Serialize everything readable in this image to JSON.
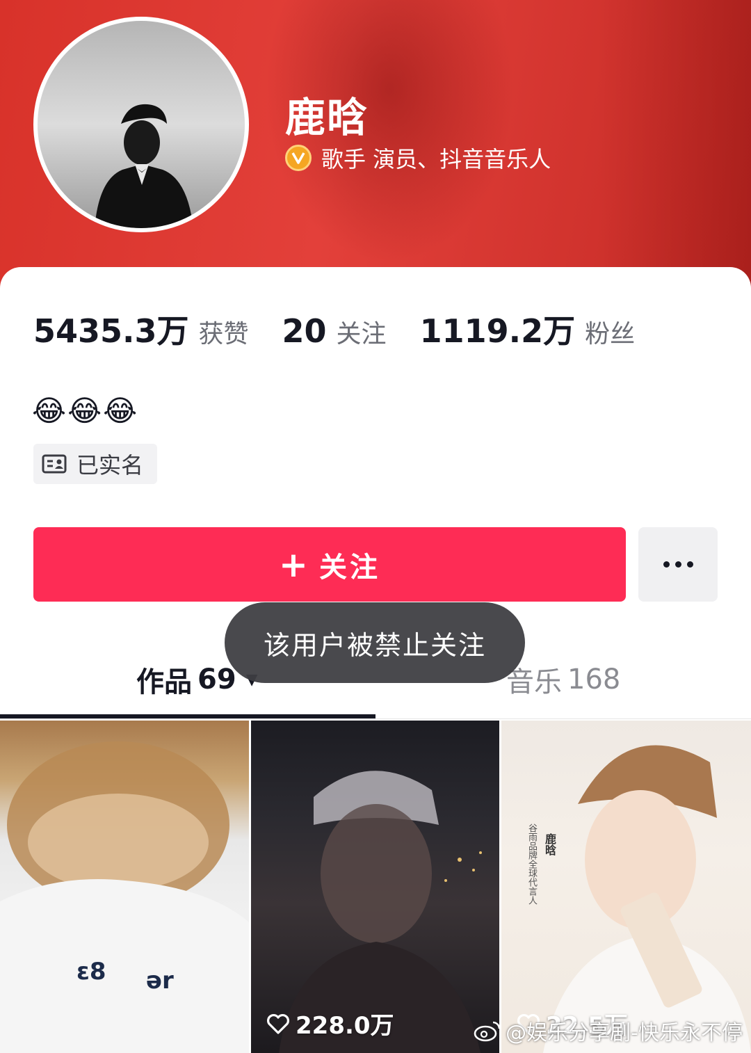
{
  "profile": {
    "name": "鹿晗",
    "verified_title": "歌手 演员、抖音音乐人",
    "bio": "😂😂😂",
    "real_name_tag": "已实名"
  },
  "stats": [
    {
      "value": "5435.3万",
      "label": "获赞"
    },
    {
      "value": "20",
      "label": "关注"
    },
    {
      "value": "1119.2万",
      "label": "粉丝"
    }
  ],
  "actions": {
    "follow_plus": "+",
    "follow_label": "关注"
  },
  "toast": {
    "text": "该用户被禁止关注"
  },
  "tabs": {
    "works": {
      "label": "作品",
      "count": "69"
    },
    "music": {
      "label": "音乐",
      "count": "168"
    }
  },
  "thumbnails": [
    {
      "likes": ""
    },
    {
      "likes": "228.0万"
    },
    {
      "likes": "22.5万"
    }
  ],
  "poster_text": {
    "line": "谷雨品牌全球代言人",
    "name": "鹿晗"
  },
  "watermark": {
    "text": "@娱乐分享剧-快乐永不停"
  },
  "colors": {
    "header_red": "#d8322a",
    "follow_button": "#fe2c55",
    "verify_badge": "#f5a623"
  },
  "icons": {
    "verify": "verified-v-icon",
    "real_name": "id-card-icon",
    "more": "more-dots-icon",
    "heart": "heart-outline-icon",
    "weibo": "weibo-logo-icon",
    "caret": "caret-down-icon"
  }
}
